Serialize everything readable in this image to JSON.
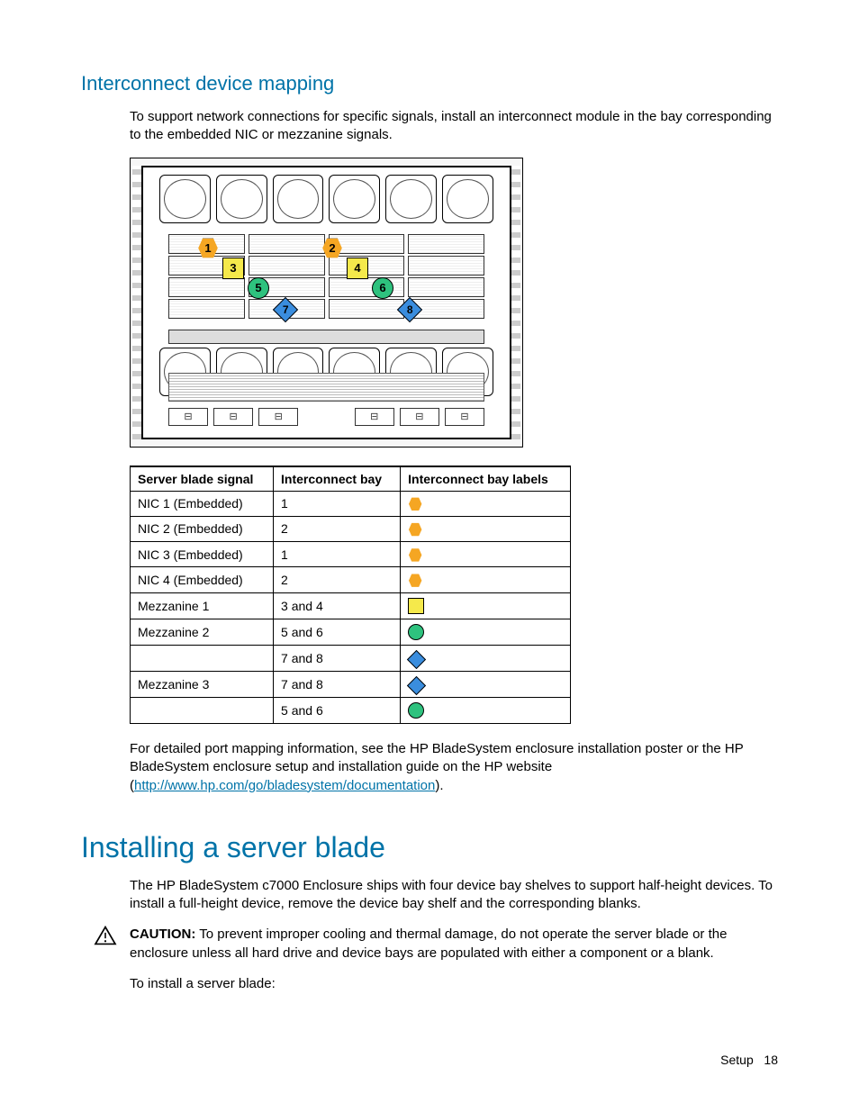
{
  "section1": {
    "heading": "Interconnect device mapping",
    "intro": "To support network connections for specific signals, install an interconnect module in the bay corresponding to the embedded NIC or mezzanine signals."
  },
  "diagram": {
    "markers": [
      "1",
      "2",
      "3",
      "4",
      "5",
      "6",
      "7",
      "8"
    ]
  },
  "table": {
    "headers": [
      "Server blade signal",
      "Interconnect bay",
      "Interconnect bay labels"
    ],
    "rows": [
      {
        "signal": "NIC 1 (Embedded)",
        "bay": "1",
        "shape": "hex"
      },
      {
        "signal": "NIC 2 (Embedded)",
        "bay": "2",
        "shape": "hex"
      },
      {
        "signal": "NIC 3 (Embedded)",
        "bay": "1",
        "shape": "hex"
      },
      {
        "signal": "NIC 4 (Embedded)",
        "bay": "2",
        "shape": "hex"
      },
      {
        "signal": "Mezzanine 1",
        "bay": "3 and 4",
        "shape": "square"
      },
      {
        "signal": "Mezzanine 2",
        "bay": "5 and 6",
        "shape": "circle"
      },
      {
        "signal": "",
        "bay": "7 and 8",
        "shape": "diamond"
      },
      {
        "signal": "Mezzanine 3",
        "bay": "7 and 8",
        "shape": "diamond"
      },
      {
        "signal": "",
        "bay": "5 and 6",
        "shape": "circle"
      }
    ]
  },
  "after_table": {
    "text_before_link": "For detailed port mapping information, see the HP BladeSystem enclosure installation poster or the HP BladeSystem enclosure setup and installation guide on the HP website (",
    "link_text": "http://www.hp.com/go/bladesystem/documentation",
    "text_after_link": ")."
  },
  "section2": {
    "heading": "Installing a server blade",
    "para1": "The HP BladeSystem c7000 Enclosure ships with four device bay shelves to support half-height devices. To install a full-height device, remove the device bay shelf and the corresponding blanks.",
    "caution_label": "CAUTION:",
    "caution_text": "To prevent improper cooling and thermal damage, do not operate the server blade or the enclosure unless all hard drive and device bays are populated with either a component or a blank.",
    "para2": "To install a server blade:"
  },
  "footer": {
    "section": "Setup",
    "page": "18"
  }
}
